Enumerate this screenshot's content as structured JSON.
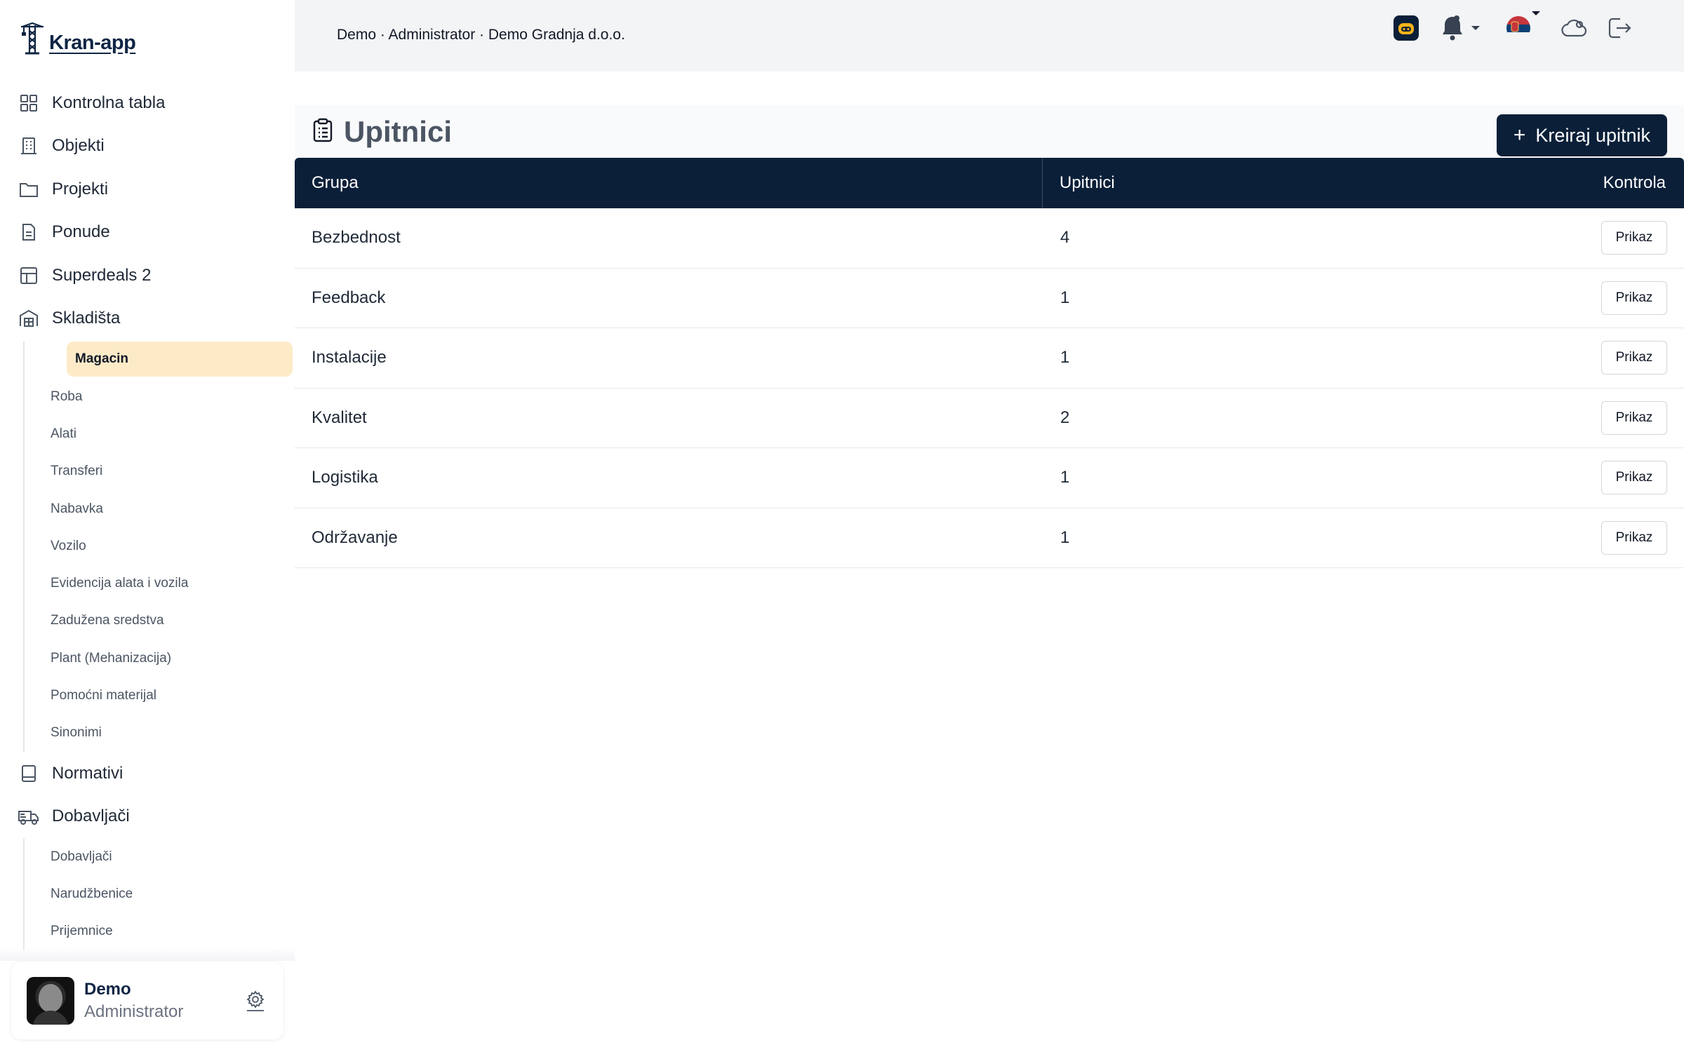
{
  "app": {
    "logo_text": "Kran-app"
  },
  "breadcrumb": "Demo · Administrator · Demo Gradnja d.o.o.",
  "sidebar": {
    "items": [
      {
        "label": "Kontrolna tabla",
        "icon": "grid-icon"
      },
      {
        "label": "Objekti",
        "icon": "building-icon"
      },
      {
        "label": "Projekti",
        "icon": "folder-icon"
      },
      {
        "label": "Ponude",
        "icon": "document-icon"
      },
      {
        "label": "Superdeals 2",
        "icon": "table-icon"
      },
      {
        "label": "Skladišta",
        "icon": "warehouse-icon"
      }
    ],
    "skladista_sub": [
      "Magacin",
      "Roba",
      "Alati",
      "Transferi",
      "Nabavka",
      "Vozilo",
      "Evidencija alata i vozila",
      "Zadužena sredstva",
      "Plant (Mehanizacija)",
      "Pomoćni materijal",
      "Sinonimi"
    ],
    "items2": [
      {
        "label": "Normativi",
        "icon": "book-icon"
      },
      {
        "label": "Dobavljači",
        "icon": "truck-icon"
      }
    ],
    "dobavljaci_sub": [
      "Dobavljači",
      "Narudžbenice",
      "Prijemnice"
    ],
    "active_sub": "Magacin"
  },
  "user": {
    "name": "Demo",
    "role": "Administrator"
  },
  "page": {
    "title": "Upitnici",
    "create_label": "Kreiraj upitnik",
    "create_plus": "+"
  },
  "table": {
    "headers": {
      "grupa": "Grupa",
      "upitnici": "Upitnici",
      "kontrola": "Kontrola"
    },
    "rows": [
      {
        "grupa": "Bezbednost",
        "upitnici": "4",
        "action": "Prikaz"
      },
      {
        "grupa": "Feedback",
        "upitnici": "1",
        "action": "Prikaz"
      },
      {
        "grupa": "Instalacije",
        "upitnici": "1",
        "action": "Prikaz"
      },
      {
        "grupa": "Kvalitet",
        "upitnici": "2",
        "action": "Prikaz"
      },
      {
        "grupa": "Logistika",
        "upitnici": "1",
        "action": "Prikaz"
      },
      {
        "grupa": "Održavanje",
        "upitnici": "1",
        "action": "Prikaz"
      }
    ]
  },
  "colors": {
    "navy": "#0b1f38",
    "active_bg": "#fdebc8",
    "topbar_bg": "#f3f4f6"
  }
}
